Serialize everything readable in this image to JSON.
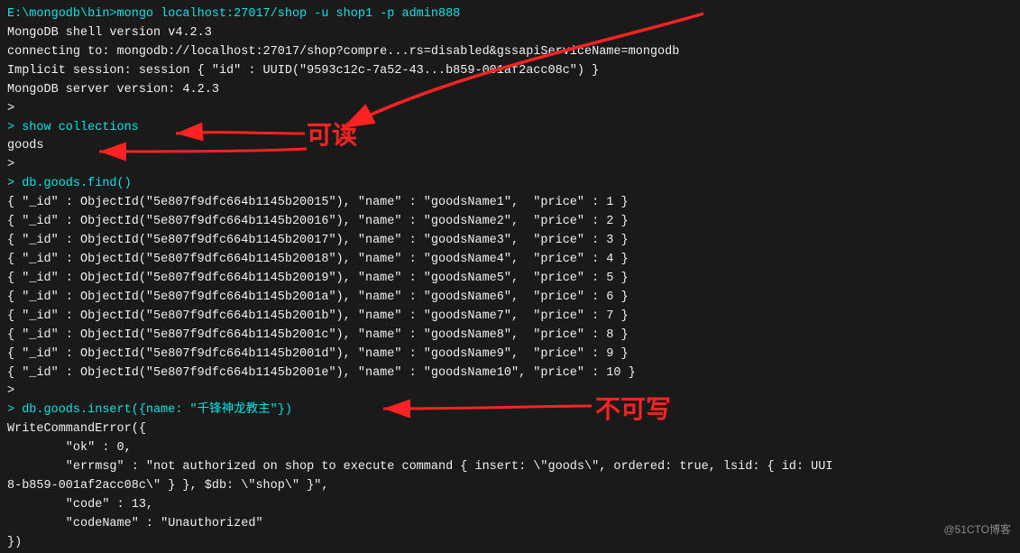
{
  "terminal": {
    "lines": [
      {
        "text": "E:\\mongodb\\bin>mongo localhost:27017/shop -u shop1 -p admin888",
        "color": "cyan"
      },
      {
        "text": "MongoDB shell version v4.2.3",
        "color": "white"
      },
      {
        "text": "connecting to: mongodb://localhost:27017/shop?compre...rs=disabled&gssapiServiceName=mongodb",
        "color": "white"
      },
      {
        "text": "Implicit session: session { \"id\" : UUID(\"9593c12c-7a52-43...b859-001af2acc08c\") }",
        "color": "white"
      },
      {
        "text": "MongoDB server version: 4.2.3",
        "color": "white"
      },
      {
        "text": "> ",
        "color": "white"
      },
      {
        "text": "> show collections",
        "color": "cyan"
      },
      {
        "text": "goods",
        "color": "white"
      },
      {
        "text": "> ",
        "color": "white"
      },
      {
        "text": "> db.goods.find()",
        "color": "cyan"
      },
      {
        "text": "{ \"_id\" : ObjectId(\"5e807f9dfc664b1145b20015\"), \"name\" : \"goodsName1\",  \"price\" : 1 }",
        "color": "white"
      },
      {
        "text": "{ \"_id\" : ObjectId(\"5e807f9dfc664b1145b20016\"), \"name\" : \"goodsName2\",  \"price\" : 2 }",
        "color": "white"
      },
      {
        "text": "{ \"_id\" : ObjectId(\"5e807f9dfc664b1145b20017\"), \"name\" : \"goodsName3\",  \"price\" : 3 }",
        "color": "white"
      },
      {
        "text": "{ \"_id\" : ObjectId(\"5e807f9dfc664b1145b20018\"), \"name\" : \"goodsName4\",  \"price\" : 4 }",
        "color": "white"
      },
      {
        "text": "{ \"_id\" : ObjectId(\"5e807f9dfc664b1145b20019\"), \"name\" : \"goodsName5\",  \"price\" : 5 }",
        "color": "white"
      },
      {
        "text": "{ \"_id\" : ObjectId(\"5e807f9dfc664b1145b2001a\"), \"name\" : \"goodsName6\",  \"price\" : 6 }",
        "color": "white"
      },
      {
        "text": "{ \"_id\" : ObjectId(\"5e807f9dfc664b1145b2001b\"), \"name\" : \"goodsName7\",  \"price\" : 7 }",
        "color": "white"
      },
      {
        "text": "{ \"_id\" : ObjectId(\"5e807f9dfc664b1145b2001c\"), \"name\" : \"goodsName8\",  \"price\" : 8 }",
        "color": "white"
      },
      {
        "text": "{ \"_id\" : ObjectId(\"5e807f9dfc664b1145b2001d\"), \"name\" : \"goodsName9\",  \"price\" : 9 }",
        "color": "white"
      },
      {
        "text": "{ \"_id\" : ObjectId(\"5e807f9dfc664b1145b2001e\"), \"name\" : \"goodsName10\", \"price\" : 10 }",
        "color": "white"
      },
      {
        "text": "> ",
        "color": "white"
      },
      {
        "text": "> db.goods.insert({name: \"千锋神龙教主\"})",
        "color": "cyan"
      },
      {
        "text": "WriteCommandError({",
        "color": "white"
      },
      {
        "text": "        \"ok\" : 0,",
        "color": "white"
      },
      {
        "text": "        \"errmsg\" : \"not authorized on shop to execute command { insert: \\\"goods\\\", ordered: true, lsid: { id: UUI",
        "color": "white"
      },
      {
        "text": "8-b859-001af2acc08c\\\" } }, $db: \\\"shop\\\" }\",",
        "color": "white"
      },
      {
        "text": "        \"code\" : 13,",
        "color": "white"
      },
      {
        "text": "        \"codeName\" : \"Unauthorized\"",
        "color": "white"
      },
      {
        "text": "})",
        "color": "white"
      }
    ],
    "annotations": {
      "kedu": "可读",
      "bukexie": "不可写"
    },
    "watermark": "@51CTO博客"
  }
}
